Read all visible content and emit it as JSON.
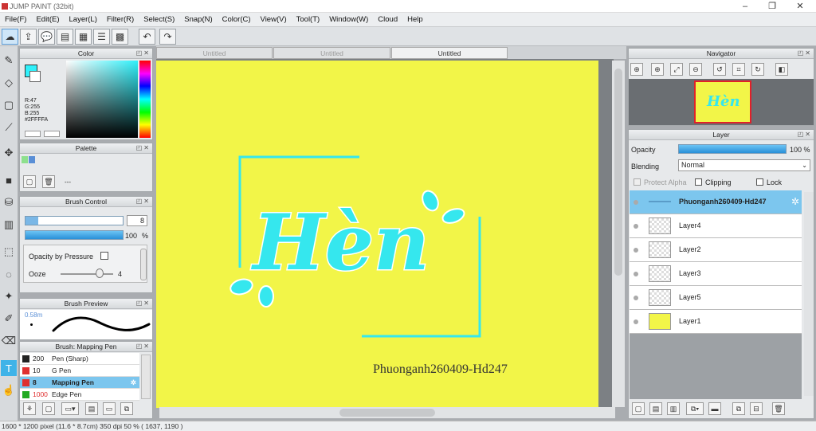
{
  "app": {
    "title": "JUMP PAINT (32bit)"
  },
  "window": {
    "minimize": "–",
    "restore": "❐",
    "close": "✕"
  },
  "menu": [
    "File(F)",
    "Edit(E)",
    "Layer(L)",
    "Filter(R)",
    "Select(S)",
    "Snap(N)",
    "Color(C)",
    "View(V)",
    "Tool(T)",
    "Window(W)",
    "Cloud",
    "Help"
  ],
  "tabs": [
    "Untitled",
    "Untitled",
    "Untitled"
  ],
  "color_panel": {
    "title": "Color",
    "r": "R:47",
    "g": "G:255",
    "b": "B:255",
    "hex": "#2FFFFA",
    "fg": "#2ff0fa"
  },
  "palette_panel": {
    "title": "Palette",
    "dash": "---"
  },
  "brush_control": {
    "title": "Brush Control",
    "size": "8",
    "opacity": "100",
    "percent": "%",
    "opacity_pressure": "Opacity by Pressure",
    "ooze_label": "Ooze",
    "ooze_value": "4"
  },
  "brush_preview": {
    "title": "Brush Preview",
    "size": "0.58m"
  },
  "brush_list": {
    "title": "Brush: Mapping Pen",
    "items": [
      {
        "num": "200",
        "name": "Pen (Sharp)",
        "color": "#222222"
      },
      {
        "num": "10",
        "name": "G Pen",
        "color": "#e03030"
      },
      {
        "num": "8",
        "name": "Mapping Pen",
        "color": "#e03030"
      },
      {
        "num": "1000",
        "name": "Edge Pen",
        "color": "#22aa22"
      }
    ]
  },
  "navigator": {
    "title": "Navigator"
  },
  "layer_panel": {
    "title": "Layer",
    "opacity_label": "Opacity",
    "opacity_value": "100 %",
    "blending_label": "Blending",
    "blending_value": "Normal",
    "protect_alpha": "Protect Alpha",
    "clipping": "Clipping",
    "lock": "Lock",
    "layers": [
      "Phuonganh260409-Hd247",
      "Layer4",
      "Layer2",
      "Layer3",
      "Layer5",
      "Layer1"
    ]
  },
  "artwork": {
    "main_text": "Hèn",
    "signature": "Phuonganh260409-Hd247",
    "ink": "#35e7ee",
    "paper": "#f2f548"
  },
  "status": "1600 * 1200 pixel   (11.6 * 8.7cm)  350 dpi   50 %   ( 1637, 1190 )"
}
